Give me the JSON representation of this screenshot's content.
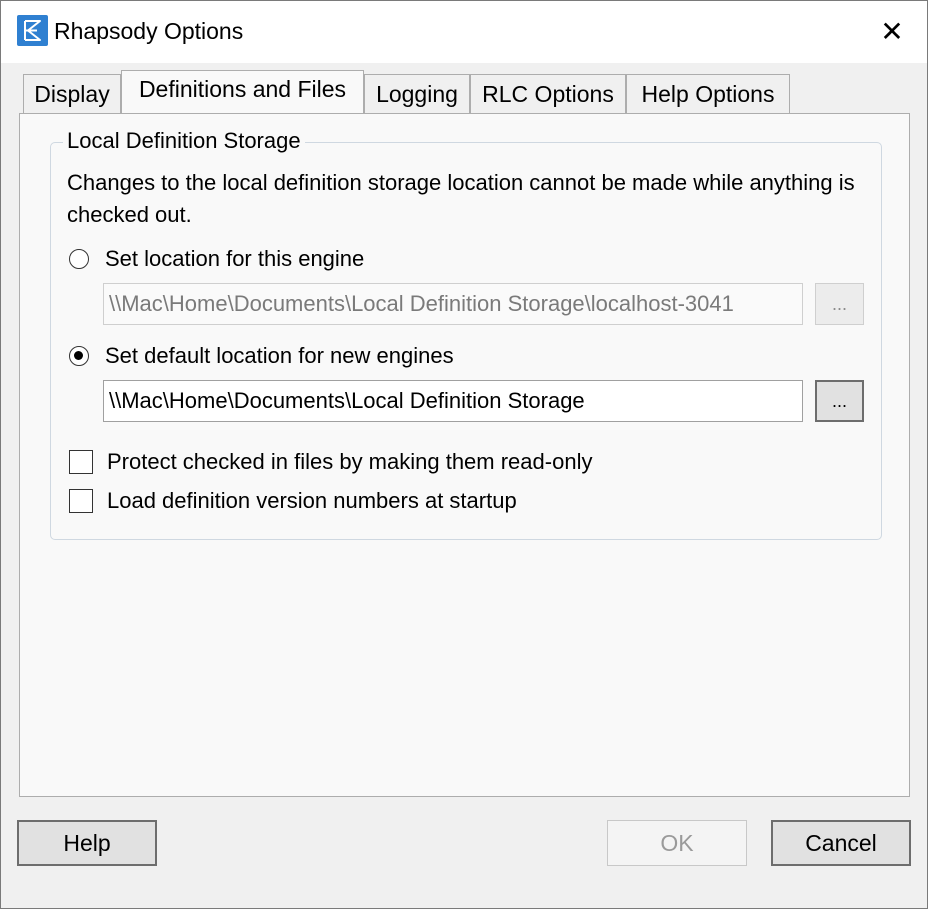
{
  "window": {
    "title": "Rhapsody Options",
    "icon": "rhapsody-logo-icon",
    "close_glyph": "✕"
  },
  "tabs": [
    {
      "label": "Display",
      "active": false
    },
    {
      "label": "Definitions and Files",
      "active": true
    },
    {
      "label": "Logging",
      "active": false
    },
    {
      "label": "RLC Options",
      "active": false
    },
    {
      "label": "Help Options",
      "active": false
    }
  ],
  "storage": {
    "group_title": "Local Definition Storage",
    "description": "Changes to the local definition storage location cannot be made while anything is checked out.",
    "engine_option": {
      "label": "Set location for this engine",
      "selected": false,
      "path": "\\\\Mac\\Home\\Documents\\Local Definition Storage\\localhost-3041",
      "browse_label": "...",
      "enabled": false
    },
    "default_option": {
      "label": "Set default location for new engines",
      "selected": true,
      "path": "\\\\Mac\\Home\\Documents\\Local Definition Storage",
      "browse_label": "...",
      "enabled": true
    },
    "protect_checkbox": {
      "label": "Protect checked in files by making them read-only",
      "checked": false
    },
    "load_checkbox": {
      "label": "Load definition version numbers at startup",
      "checked": false
    }
  },
  "buttons": {
    "help": "Help",
    "ok": "OK",
    "cancel": "Cancel"
  },
  "colors": {
    "accent": "#2f80d1",
    "window_bg": "#f0f0f0",
    "panel_bg": "#f9f9f9"
  }
}
